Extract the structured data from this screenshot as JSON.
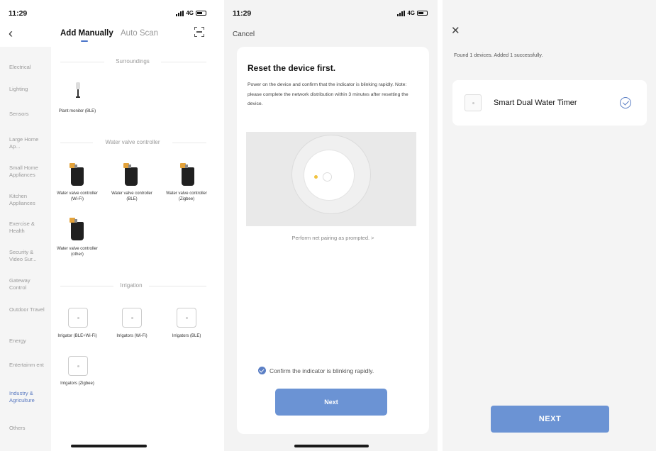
{
  "status_bar": {
    "time": "11:29",
    "network": "4G"
  },
  "screen1": {
    "tabs": {
      "manual": "Add Manually",
      "auto": "Auto Scan"
    },
    "categories": [
      "Electrical",
      "Lighting",
      "Sensors",
      "Large Home Ap...",
      "Small Home Appliances",
      "Kitchen Appliances",
      "Exercise & Health",
      "Security & Video Sur...",
      "Gateway Control",
      "Outdoor Travel",
      "Energy",
      "Entertainm ent",
      "Industry & Agriculture",
      "Others"
    ],
    "selected_category": "Industry & Agriculture",
    "sections": {
      "surroundings": "Surroundings",
      "valve": "Water valve controller",
      "irrigation": "Irrigation"
    },
    "devices": {
      "plant_monitor": "Plant monitor (BLE)",
      "valve_wifi": "Water valve controller (Wi-Fi)",
      "valve_ble": "Water valve controller (BLE)",
      "valve_zigbee": "Water valve controller (Zigbee)",
      "valve_other": "Water valve controller (other)",
      "irr_blewifi": "Irrigator (BLE+Wi-Fi)",
      "irr_wifi": "Irrigators (Wi-Fi)",
      "irr_ble": "Irrigators (BLE)",
      "irr_zigbee": "Irrigators (Zigbee)"
    }
  },
  "screen2": {
    "cancel": "Cancel",
    "title": "Reset the device first.",
    "description": "Power on the device and confirm that the indicator is blinking rapidly. Note: please complete the network distribution within 3 minutes after resetting the device.",
    "pairing_link": "Perform net pairing as prompted. >",
    "confirm": "Confirm the indicator is blinking rapidly.",
    "next": "Next"
  },
  "screen3": {
    "found": "Found 1 devices. Added 1 successfully.",
    "device_name": "Smart Dual Water Timer",
    "next": "NEXT"
  },
  "colors": {
    "accent": "#5b7fc5",
    "button": "#6b93d4",
    "indicator": "#f1c340"
  }
}
